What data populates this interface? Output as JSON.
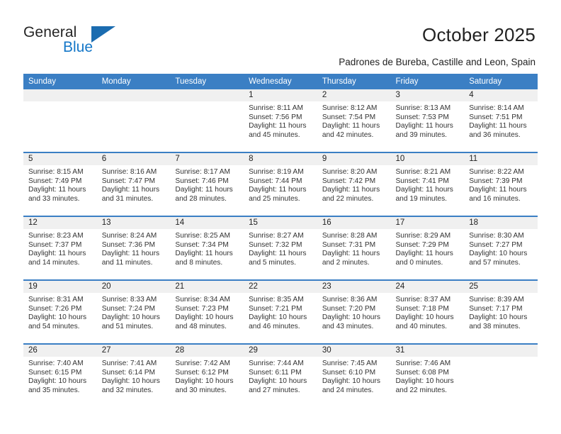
{
  "brand": {
    "name_part1": "General",
    "name_part2": "Blue",
    "accent_color": "#1b6cb0",
    "blue_text_color": "#1477c8"
  },
  "header": {
    "title": "October 2025",
    "subtitle": "Padrones de Bureba, Castille and Leon, Spain"
  },
  "calendar": {
    "header_bg": "#3b7fc4",
    "daynum_band_bg": "#f0f0f0",
    "weekday_headers": [
      "Sunday",
      "Monday",
      "Tuesday",
      "Wednesday",
      "Thursday",
      "Friday",
      "Saturday"
    ],
    "labels": {
      "sunrise_prefix": "Sunrise:",
      "sunset_prefix": "Sunset:",
      "daylight_prefix": "Daylight:"
    },
    "weeks": [
      [
        {
          "day": "",
          "empty": true
        },
        {
          "day": "",
          "empty": true
        },
        {
          "day": "",
          "empty": true
        },
        {
          "day": "1",
          "sunrise": "Sunrise: 8:11 AM",
          "sunset": "Sunset: 7:56 PM",
          "daylight": "Daylight: 11 hours and 45 minutes."
        },
        {
          "day": "2",
          "sunrise": "Sunrise: 8:12 AM",
          "sunset": "Sunset: 7:54 PM",
          "daylight": "Daylight: 11 hours and 42 minutes."
        },
        {
          "day": "3",
          "sunrise": "Sunrise: 8:13 AM",
          "sunset": "Sunset: 7:53 PM",
          "daylight": "Daylight: 11 hours and 39 minutes."
        },
        {
          "day": "4",
          "sunrise": "Sunrise: 8:14 AM",
          "sunset": "Sunset: 7:51 PM",
          "daylight": "Daylight: 11 hours and 36 minutes."
        }
      ],
      [
        {
          "day": "5",
          "sunrise": "Sunrise: 8:15 AM",
          "sunset": "Sunset: 7:49 PM",
          "daylight": "Daylight: 11 hours and 33 minutes."
        },
        {
          "day": "6",
          "sunrise": "Sunrise: 8:16 AM",
          "sunset": "Sunset: 7:47 PM",
          "daylight": "Daylight: 11 hours and 31 minutes."
        },
        {
          "day": "7",
          "sunrise": "Sunrise: 8:17 AM",
          "sunset": "Sunset: 7:46 PM",
          "daylight": "Daylight: 11 hours and 28 minutes."
        },
        {
          "day": "8",
          "sunrise": "Sunrise: 8:19 AM",
          "sunset": "Sunset: 7:44 PM",
          "daylight": "Daylight: 11 hours and 25 minutes."
        },
        {
          "day": "9",
          "sunrise": "Sunrise: 8:20 AM",
          "sunset": "Sunset: 7:42 PM",
          "daylight": "Daylight: 11 hours and 22 minutes."
        },
        {
          "day": "10",
          "sunrise": "Sunrise: 8:21 AM",
          "sunset": "Sunset: 7:41 PM",
          "daylight": "Daylight: 11 hours and 19 minutes."
        },
        {
          "day": "11",
          "sunrise": "Sunrise: 8:22 AM",
          "sunset": "Sunset: 7:39 PM",
          "daylight": "Daylight: 11 hours and 16 minutes."
        }
      ],
      [
        {
          "day": "12",
          "sunrise": "Sunrise: 8:23 AM",
          "sunset": "Sunset: 7:37 PM",
          "daylight": "Daylight: 11 hours and 14 minutes."
        },
        {
          "day": "13",
          "sunrise": "Sunrise: 8:24 AM",
          "sunset": "Sunset: 7:36 PM",
          "daylight": "Daylight: 11 hours and 11 minutes."
        },
        {
          "day": "14",
          "sunrise": "Sunrise: 8:25 AM",
          "sunset": "Sunset: 7:34 PM",
          "daylight": "Daylight: 11 hours and 8 minutes."
        },
        {
          "day": "15",
          "sunrise": "Sunrise: 8:27 AM",
          "sunset": "Sunset: 7:32 PM",
          "daylight": "Daylight: 11 hours and 5 minutes."
        },
        {
          "day": "16",
          "sunrise": "Sunrise: 8:28 AM",
          "sunset": "Sunset: 7:31 PM",
          "daylight": "Daylight: 11 hours and 2 minutes."
        },
        {
          "day": "17",
          "sunrise": "Sunrise: 8:29 AM",
          "sunset": "Sunset: 7:29 PM",
          "daylight": "Daylight: 11 hours and 0 minutes."
        },
        {
          "day": "18",
          "sunrise": "Sunrise: 8:30 AM",
          "sunset": "Sunset: 7:27 PM",
          "daylight": "Daylight: 10 hours and 57 minutes."
        }
      ],
      [
        {
          "day": "19",
          "sunrise": "Sunrise: 8:31 AM",
          "sunset": "Sunset: 7:26 PM",
          "daylight": "Daylight: 10 hours and 54 minutes."
        },
        {
          "day": "20",
          "sunrise": "Sunrise: 8:33 AM",
          "sunset": "Sunset: 7:24 PM",
          "daylight": "Daylight: 10 hours and 51 minutes."
        },
        {
          "day": "21",
          "sunrise": "Sunrise: 8:34 AM",
          "sunset": "Sunset: 7:23 PM",
          "daylight": "Daylight: 10 hours and 48 minutes."
        },
        {
          "day": "22",
          "sunrise": "Sunrise: 8:35 AM",
          "sunset": "Sunset: 7:21 PM",
          "daylight": "Daylight: 10 hours and 46 minutes."
        },
        {
          "day": "23",
          "sunrise": "Sunrise: 8:36 AM",
          "sunset": "Sunset: 7:20 PM",
          "daylight": "Daylight: 10 hours and 43 minutes."
        },
        {
          "day": "24",
          "sunrise": "Sunrise: 8:37 AM",
          "sunset": "Sunset: 7:18 PM",
          "daylight": "Daylight: 10 hours and 40 minutes."
        },
        {
          "day": "25",
          "sunrise": "Sunrise: 8:39 AM",
          "sunset": "Sunset: 7:17 PM",
          "daylight": "Daylight: 10 hours and 38 minutes."
        }
      ],
      [
        {
          "day": "26",
          "sunrise": "Sunrise: 7:40 AM",
          "sunset": "Sunset: 6:15 PM",
          "daylight": "Daylight: 10 hours and 35 minutes."
        },
        {
          "day": "27",
          "sunrise": "Sunrise: 7:41 AM",
          "sunset": "Sunset: 6:14 PM",
          "daylight": "Daylight: 10 hours and 32 minutes."
        },
        {
          "day": "28",
          "sunrise": "Sunrise: 7:42 AM",
          "sunset": "Sunset: 6:12 PM",
          "daylight": "Daylight: 10 hours and 30 minutes."
        },
        {
          "day": "29",
          "sunrise": "Sunrise: 7:44 AM",
          "sunset": "Sunset: 6:11 PM",
          "daylight": "Daylight: 10 hours and 27 minutes."
        },
        {
          "day": "30",
          "sunrise": "Sunrise: 7:45 AM",
          "sunset": "Sunset: 6:10 PM",
          "daylight": "Daylight: 10 hours and 24 minutes."
        },
        {
          "day": "31",
          "sunrise": "Sunrise: 7:46 AM",
          "sunset": "Sunset: 6:08 PM",
          "daylight": "Daylight: 10 hours and 22 minutes."
        },
        {
          "day": "",
          "empty": true
        }
      ]
    ]
  }
}
